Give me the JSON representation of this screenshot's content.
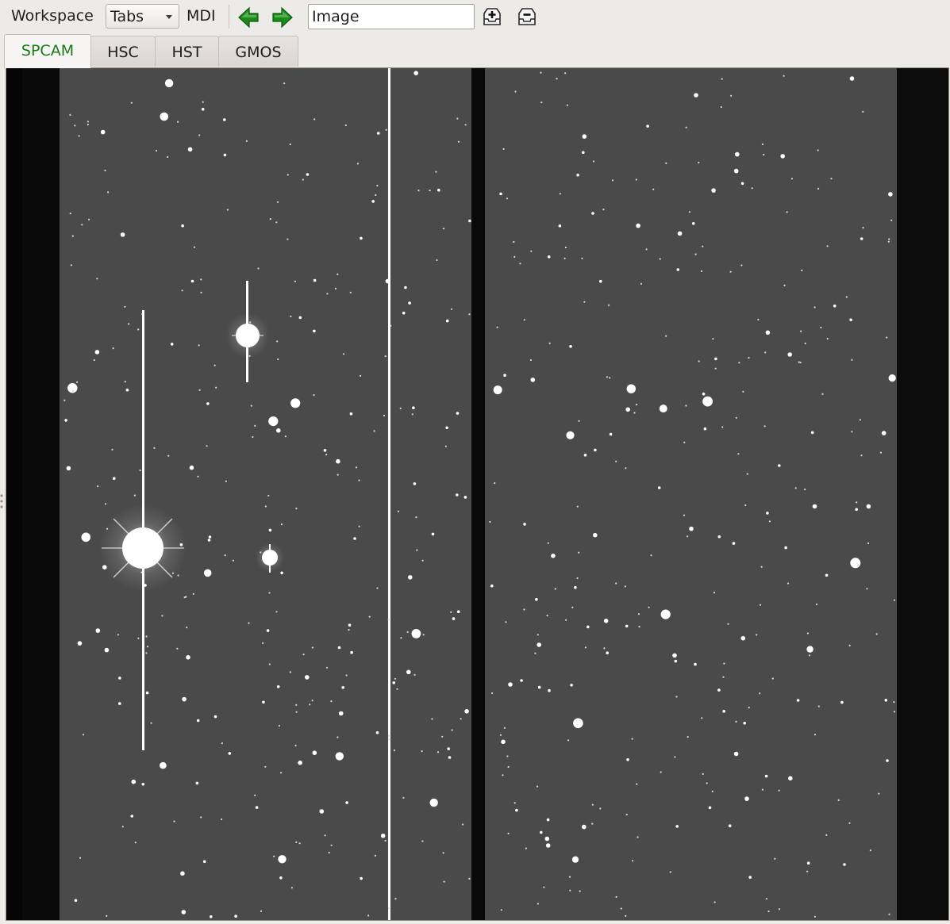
{
  "toolbar": {
    "workspace_label": "Workspace",
    "layout_select_value": "Tabs",
    "mdi_label": "MDI",
    "channel_input_value": "Image",
    "icons": {
      "prev": "arrow-left-icon",
      "next": "arrow-right-icon",
      "add": "add-channel-icon",
      "remove": "remove-channel-icon"
    }
  },
  "tabs": [
    {
      "label": "SPCAM",
      "active": true
    },
    {
      "label": "HSC",
      "active": false
    },
    {
      "label": "HST",
      "active": false
    },
    {
      "label": "GMOS",
      "active": false
    }
  ],
  "colors": {
    "active_tab_text": "#1a7a1a",
    "nav_arrow": "#1b8a1b",
    "sky_background": "#4a4a4a",
    "detector_gap": "#0a0a0a"
  }
}
